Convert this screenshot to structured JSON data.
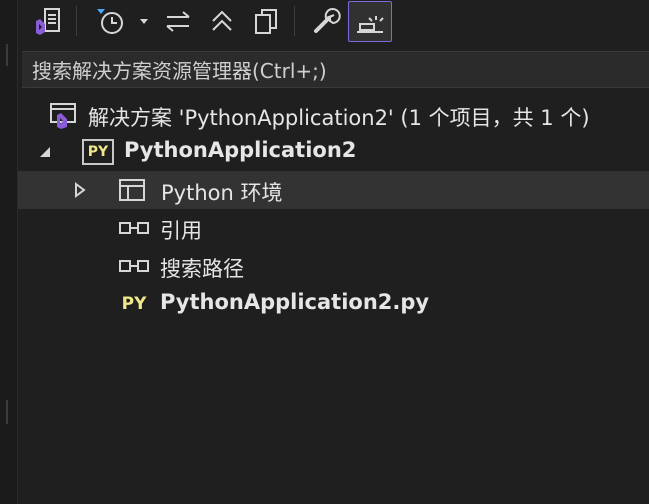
{
  "search": {
    "placeholder": "搜索解决方案资源管理器(Ctrl+;)"
  },
  "tree": {
    "solution_label": "解决方案 'PythonApplication2' (1 个项目，共 1 个)",
    "project": {
      "badge": "PY",
      "label": "PythonApplication2"
    },
    "items": [
      {
        "label": "Python 环境"
      },
      {
        "label": "引用"
      },
      {
        "label": "搜索路径"
      },
      {
        "badge": "PY",
        "label": "PythonApplication2.py"
      }
    ]
  },
  "colors": {
    "background": "#1f1f1f",
    "accent": "#7e6ad8",
    "vs_purple": "#8a5cd6",
    "python_yellow": "#f0e68c"
  }
}
